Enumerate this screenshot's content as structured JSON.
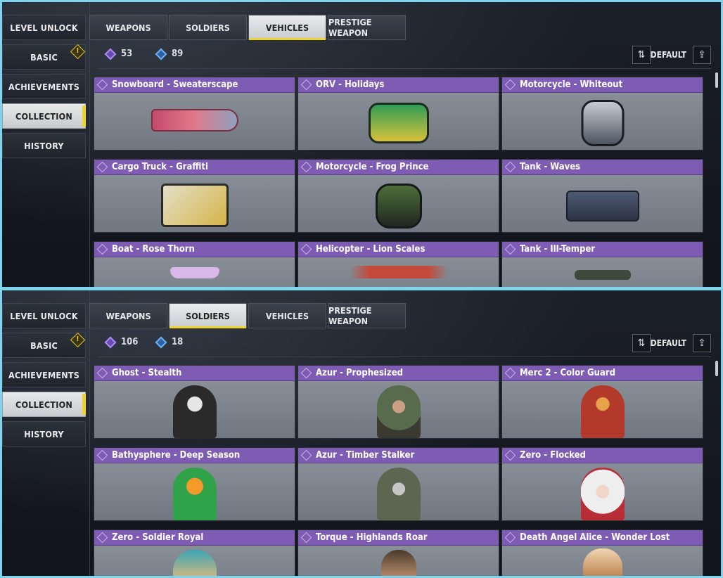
{
  "nav": [
    "LEVEL UNLOCK",
    "BASIC",
    "ACHIEVEMENTS",
    "COLLECTION",
    "HISTORY"
  ],
  "tabs": [
    "WEAPONS",
    "SOLDIERS",
    "VEHICLES",
    "PRESTIGE WEAPON"
  ],
  "sort_label": "DEFAULT",
  "top": {
    "active_tab": "VEHICLES",
    "currency_purple": "53",
    "currency_blue": "89",
    "cards": [
      "Snowboard - Sweaterscape",
      "ORV - Holidays",
      "Motorcycle - Whiteout",
      "Cargo Truck - Graffiti",
      "Motorcycle - Frog Prince",
      "Tank - Waves",
      "Boat - Rose Thorn",
      "Helicopter - Lion Scales",
      "Tank - Ill-Temper"
    ]
  },
  "bottom": {
    "active_tab": "SOLDIERS",
    "currency_purple": "106",
    "currency_blue": "18",
    "cards": [
      "Ghost - Stealth",
      "Azur - Prophesized",
      "Merc 2 - Color Guard",
      "Bathysphere - Deep Season",
      "Azur - Timber Stalker",
      "Zero - Flocked",
      "Zero - Soldier Royal",
      "Torque - Highlands Roar",
      "Death Angel Alice - Wonder Lost"
    ]
  },
  "colors": {
    "rarity_epic": "#7f5cb3",
    "accent_yellow": "#f1d42a",
    "border_cyan": "#7fd3ec"
  },
  "icons": {
    "currency_purple": "purple-diamond-icon",
    "currency_blue": "blue-diamond-icon",
    "sort": "sort-arrows-icon",
    "share": "share-icon",
    "alert": "alert-diamond-icon"
  }
}
